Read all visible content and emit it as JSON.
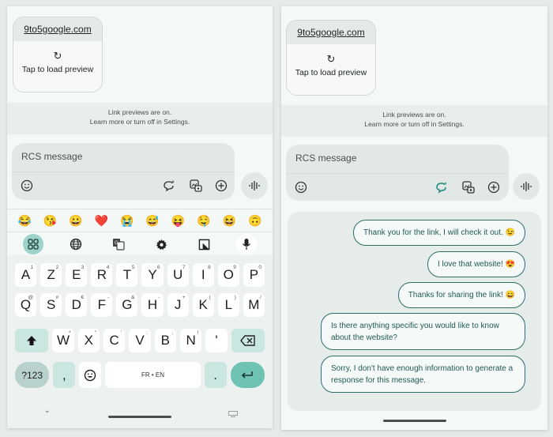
{
  "link_preview": {
    "domain": "9to5google.com",
    "refresh_icon": "refresh-icon",
    "tap_label": "Tap to load preview"
  },
  "notice": {
    "line1": "Link previews are on.",
    "line2": "Learn more or turn off in Settings."
  },
  "composer": {
    "placeholder": "RCS message"
  },
  "emoji_suggestions": [
    "😂",
    "😘",
    "😀",
    "❤️",
    "😭",
    "😅",
    "😝",
    "🤤",
    "😆",
    "🙃"
  ],
  "keyboard": {
    "row1": [
      [
        "A",
        "1"
      ],
      [
        "Z",
        "2"
      ],
      [
        "E",
        "3"
      ],
      [
        "R",
        "4"
      ],
      [
        "T",
        "5"
      ],
      [
        "Y",
        "6"
      ],
      [
        "U",
        "7"
      ],
      [
        "I",
        "8"
      ],
      [
        "O",
        "9"
      ],
      [
        "P",
        "0"
      ]
    ],
    "row2": [
      [
        "Q",
        "@"
      ],
      [
        "S",
        "#"
      ],
      [
        "D",
        "€"
      ],
      [
        "F",
        "-"
      ],
      [
        "G",
        "&"
      ],
      [
        "H",
        "-"
      ],
      [
        "J",
        "+"
      ],
      [
        "K",
        "("
      ],
      [
        "L",
        ")"
      ],
      [
        "M",
        "/"
      ]
    ],
    "row3": [
      [
        "W",
        "*"
      ],
      [
        "X",
        "\""
      ],
      [
        "C",
        "'"
      ],
      [
        "V",
        ":"
      ],
      [
        "B",
        ";"
      ],
      [
        "N",
        "!"
      ],
      [
        "'",
        ""
      ]
    ],
    "symbols_label": "?123",
    "comma": ",",
    "space_label": "FR • EN",
    "period": "."
  },
  "suggestions": [
    "Thank you for the link, I will check it out. 😉",
    "I love that website! 😍",
    "Thanks for sharing the link! 😄",
    "Is there anything specific you would like to know about the website?",
    "Sorry, I don't have enough information to generate a response for this message."
  ],
  "colors": {
    "accent": "#6fc3b4",
    "chip_border": "#2f6e68",
    "chip_text": "#1e5a55",
    "ai_icon": "#1a8a7e"
  }
}
